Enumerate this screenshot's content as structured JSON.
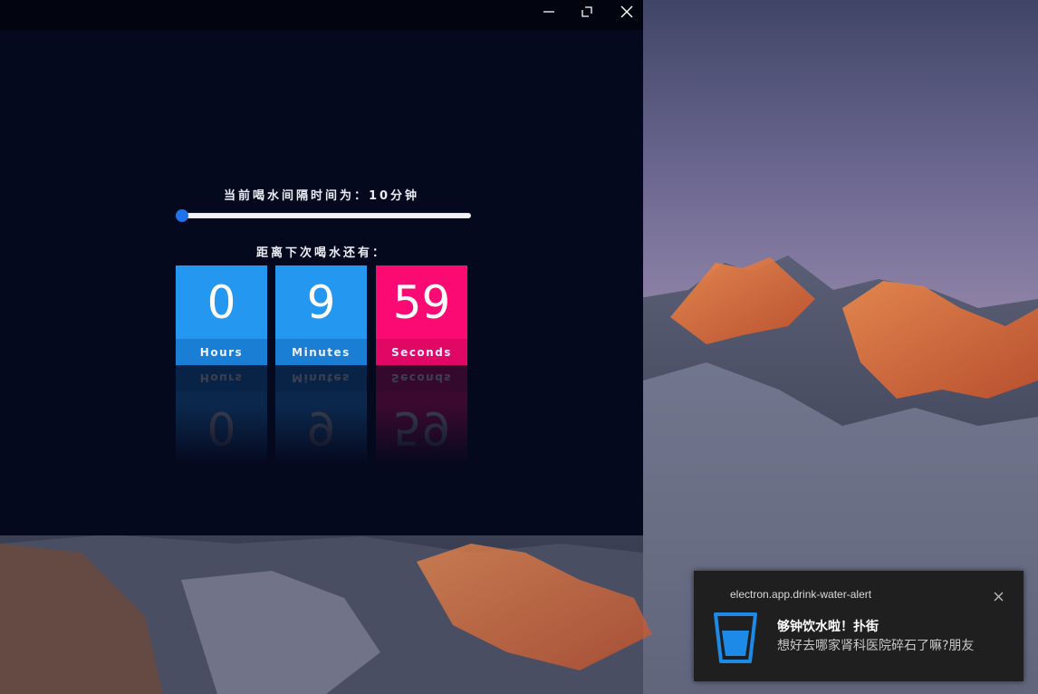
{
  "window": {
    "controls": {
      "minimize_icon": "minimize-icon",
      "maximize_icon": "maximize-icon",
      "close_icon": "close-icon"
    }
  },
  "reminder": {
    "interval_label": "当前喝水间隔时间为：10分钟",
    "interval_slider_value": 10,
    "countdown_label": "距离下次喝水还有："
  },
  "countdown": {
    "hours": {
      "value": "0",
      "unit": "Hours",
      "color": "#2497f0"
    },
    "minutes": {
      "value": "9",
      "unit": "Minutes",
      "color": "#2497f0"
    },
    "seconds": {
      "value": "59",
      "unit": "Seconds",
      "color": "#fb0a73"
    }
  },
  "notification": {
    "app_name": "electron.app.drink-water-alert",
    "title": "够钟饮水啦！扑街",
    "body": "想好去哪家肾科医院碎石了嘛?朋友",
    "icon": "water-glass-icon",
    "close_icon": "close-icon"
  },
  "colors": {
    "app_background": "#05091e",
    "accent_blue": "#2497f0",
    "accent_pink": "#fb0a73",
    "slider_thumb": "#1f73ea"
  }
}
